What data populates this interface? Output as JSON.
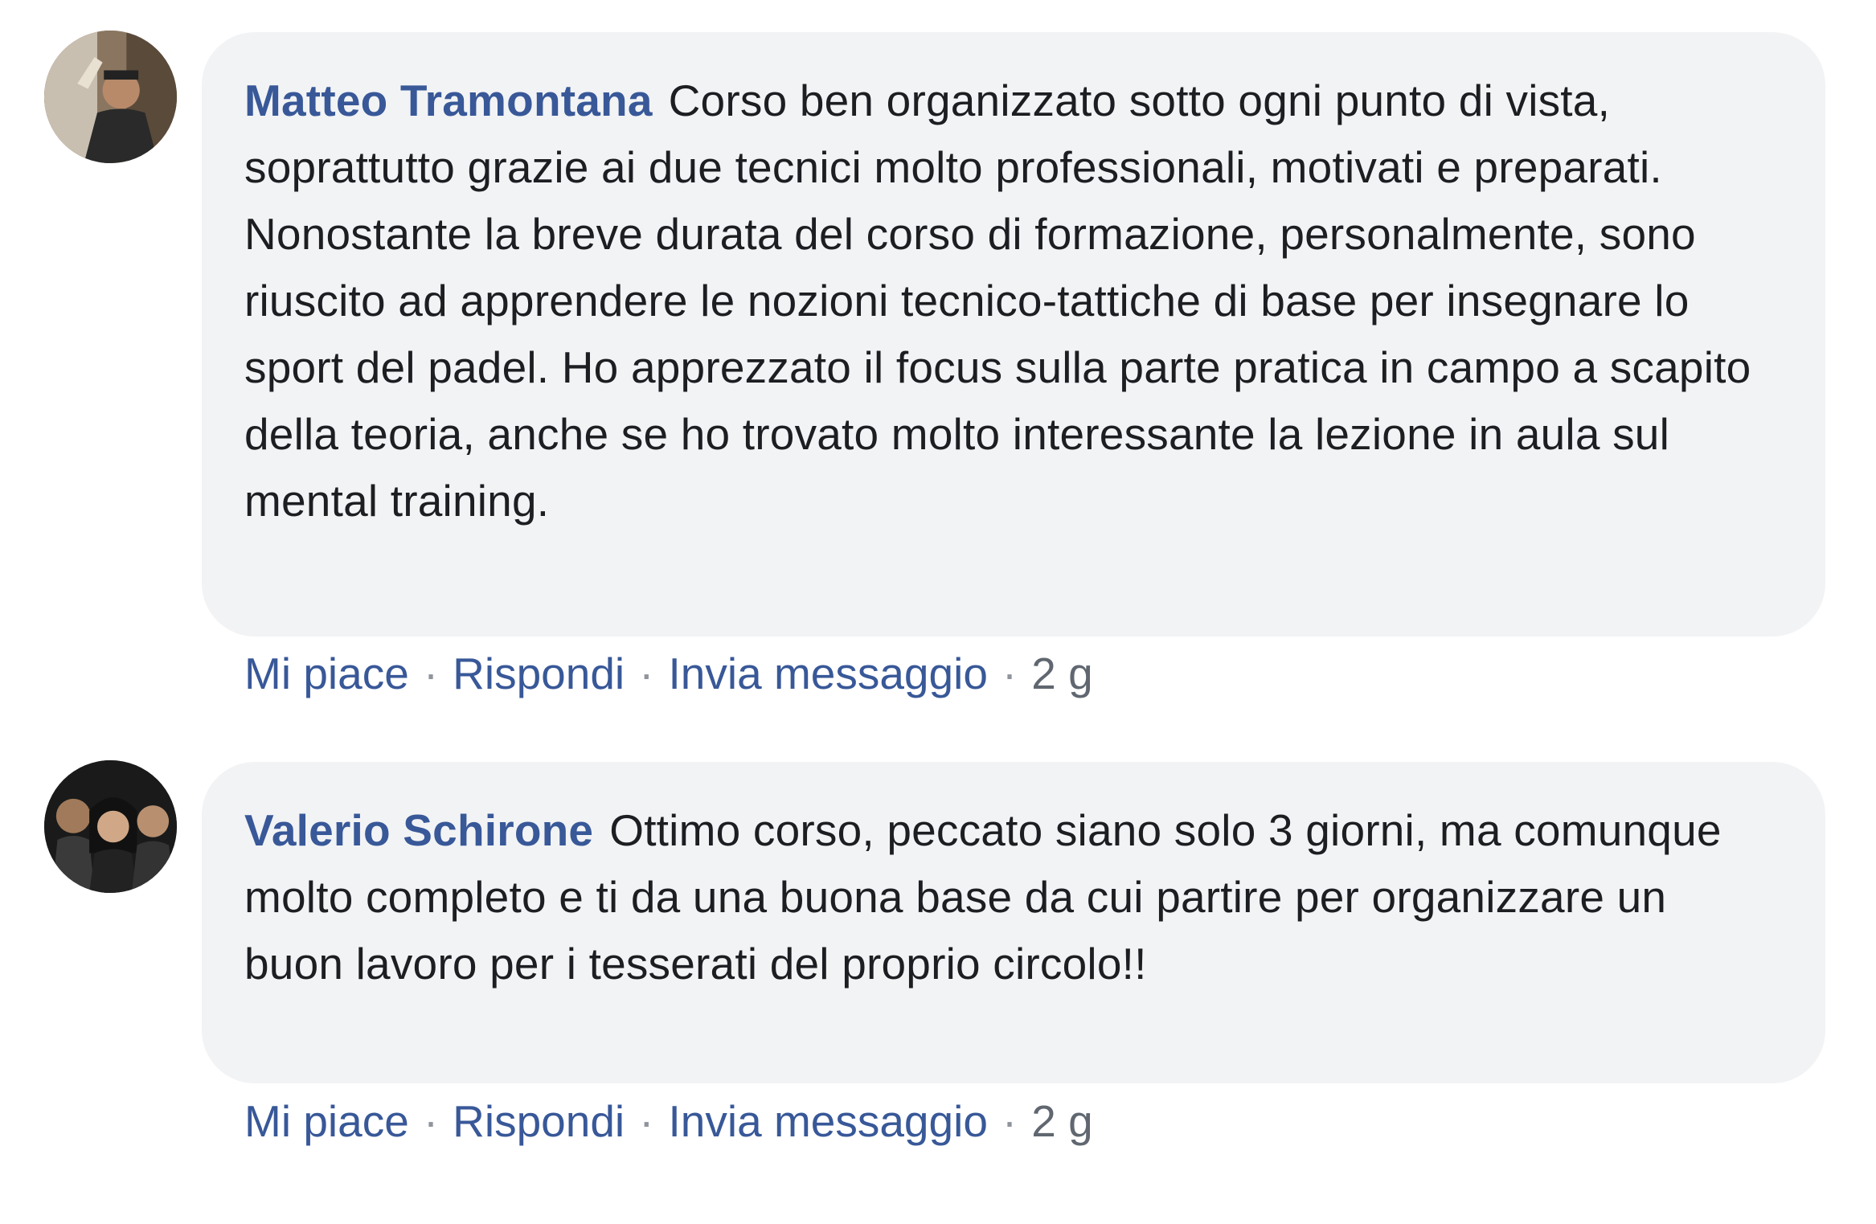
{
  "comments": [
    {
      "author": "Matteo Tramontana",
      "text": "Corso ben organizzato sotto ogni punto di vista, soprattutto grazie ai due tecnici molto professionali, motivati e preparati. Nonostante la breve durata del corso di formazione, personalmente, sono riuscito ad apprendere le nozioni tecnico-tattiche di base per insegnare lo sport del padel. Ho apprezzato il focus sulla parte pratica in campo a scapito della teoria, anche se ho trovato molto interessante la lezione in aula sul mental training.",
      "actions": {
        "like": "Mi piace",
        "reply": "Rispondi",
        "message": "Invia messaggio",
        "time": "2 g",
        "separator": "·"
      },
      "avatar_icon": "user-photo-avatar"
    },
    {
      "author": "Valerio Schirone",
      "text": "Ottimo corso, peccato siano solo 3 giorni, ma comunque molto completo e ti da una buona base da cui partire per organizzare un buon lavoro per i tesserati del proprio circolo!!",
      "actions": {
        "like": "Mi piace",
        "reply": "Rispondi",
        "message": "Invia messaggio",
        "time": "2 g",
        "separator": "·"
      },
      "avatar_icon": "group-photo-avatar"
    }
  ],
  "colors": {
    "author": "#385898",
    "text": "#1c1e21",
    "bubble": "#f2f3f5",
    "meta": "#606770"
  }
}
